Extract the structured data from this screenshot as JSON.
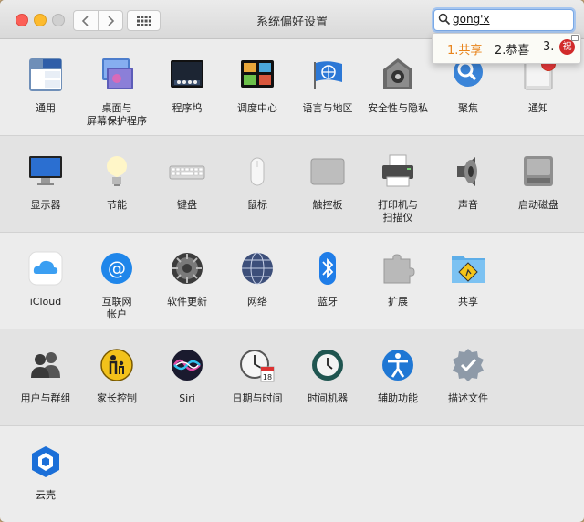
{
  "window": {
    "title": "系统偏好设置"
  },
  "search": {
    "value": "gong'x"
  },
  "ime": {
    "candidates": [
      "1.共享",
      "2.恭喜",
      "3."
    ],
    "badge": "祝"
  },
  "rows": [
    [
      {
        "id": "general",
        "label": "通用",
        "icon": "general-icon"
      },
      {
        "id": "desktop",
        "label": "桌面与\n屏幕保护程序",
        "icon": "desktop-screensaver-icon"
      },
      {
        "id": "dock",
        "label": "程序坞",
        "icon": "dock-icon"
      },
      {
        "id": "mission",
        "label": "调度中心",
        "icon": "mission-control-icon"
      },
      {
        "id": "language",
        "label": "语言与地区",
        "icon": "language-region-icon"
      },
      {
        "id": "security",
        "label": "安全性与隐私",
        "icon": "security-privacy-icon"
      },
      {
        "id": "spotlight",
        "label": "聚焦",
        "icon": "spotlight-icon"
      },
      {
        "id": "notifications",
        "label": "通知",
        "icon": "notifications-icon"
      }
    ],
    [
      {
        "id": "displays",
        "label": "显示器",
        "icon": "displays-icon"
      },
      {
        "id": "energy",
        "label": "节能",
        "icon": "energy-saver-icon"
      },
      {
        "id": "keyboard",
        "label": "键盘",
        "icon": "keyboard-icon"
      },
      {
        "id": "mouse",
        "label": "鼠标",
        "icon": "mouse-icon"
      },
      {
        "id": "trackpad",
        "label": "触控板",
        "icon": "trackpad-icon"
      },
      {
        "id": "printers",
        "label": "打印机与\n扫描仪",
        "icon": "printers-scanners-icon"
      },
      {
        "id": "sound",
        "label": "声音",
        "icon": "sound-icon"
      },
      {
        "id": "startup",
        "label": "启动磁盘",
        "icon": "startup-disk-icon"
      }
    ],
    [
      {
        "id": "icloud",
        "label": "iCloud",
        "icon": "icloud-icon"
      },
      {
        "id": "internet",
        "label": "互联网\n帐户",
        "icon": "internet-accounts-icon"
      },
      {
        "id": "update",
        "label": "软件更新",
        "icon": "software-update-icon"
      },
      {
        "id": "network",
        "label": "网络",
        "icon": "network-icon"
      },
      {
        "id": "bluetooth",
        "label": "蓝牙",
        "icon": "bluetooth-icon"
      },
      {
        "id": "extensions",
        "label": "扩展",
        "icon": "extensions-icon"
      },
      {
        "id": "sharing",
        "label": "共享",
        "icon": "sharing-icon"
      }
    ],
    [
      {
        "id": "users",
        "label": "用户与群组",
        "icon": "users-groups-icon"
      },
      {
        "id": "parental",
        "label": "家长控制",
        "icon": "parental-controls-icon"
      },
      {
        "id": "siri",
        "label": "Siri",
        "icon": "siri-icon"
      },
      {
        "id": "datetime",
        "label": "日期与时间",
        "icon": "date-time-icon"
      },
      {
        "id": "timemachine",
        "label": "时间机器",
        "icon": "time-machine-icon"
      },
      {
        "id": "accessibility",
        "label": "辅助功能",
        "icon": "accessibility-icon"
      },
      {
        "id": "profiles",
        "label": "描述文件",
        "icon": "profiles-icon"
      }
    ],
    [
      {
        "id": "yunke",
        "label": "云壳",
        "icon": "yunke-icon"
      }
    ]
  ]
}
